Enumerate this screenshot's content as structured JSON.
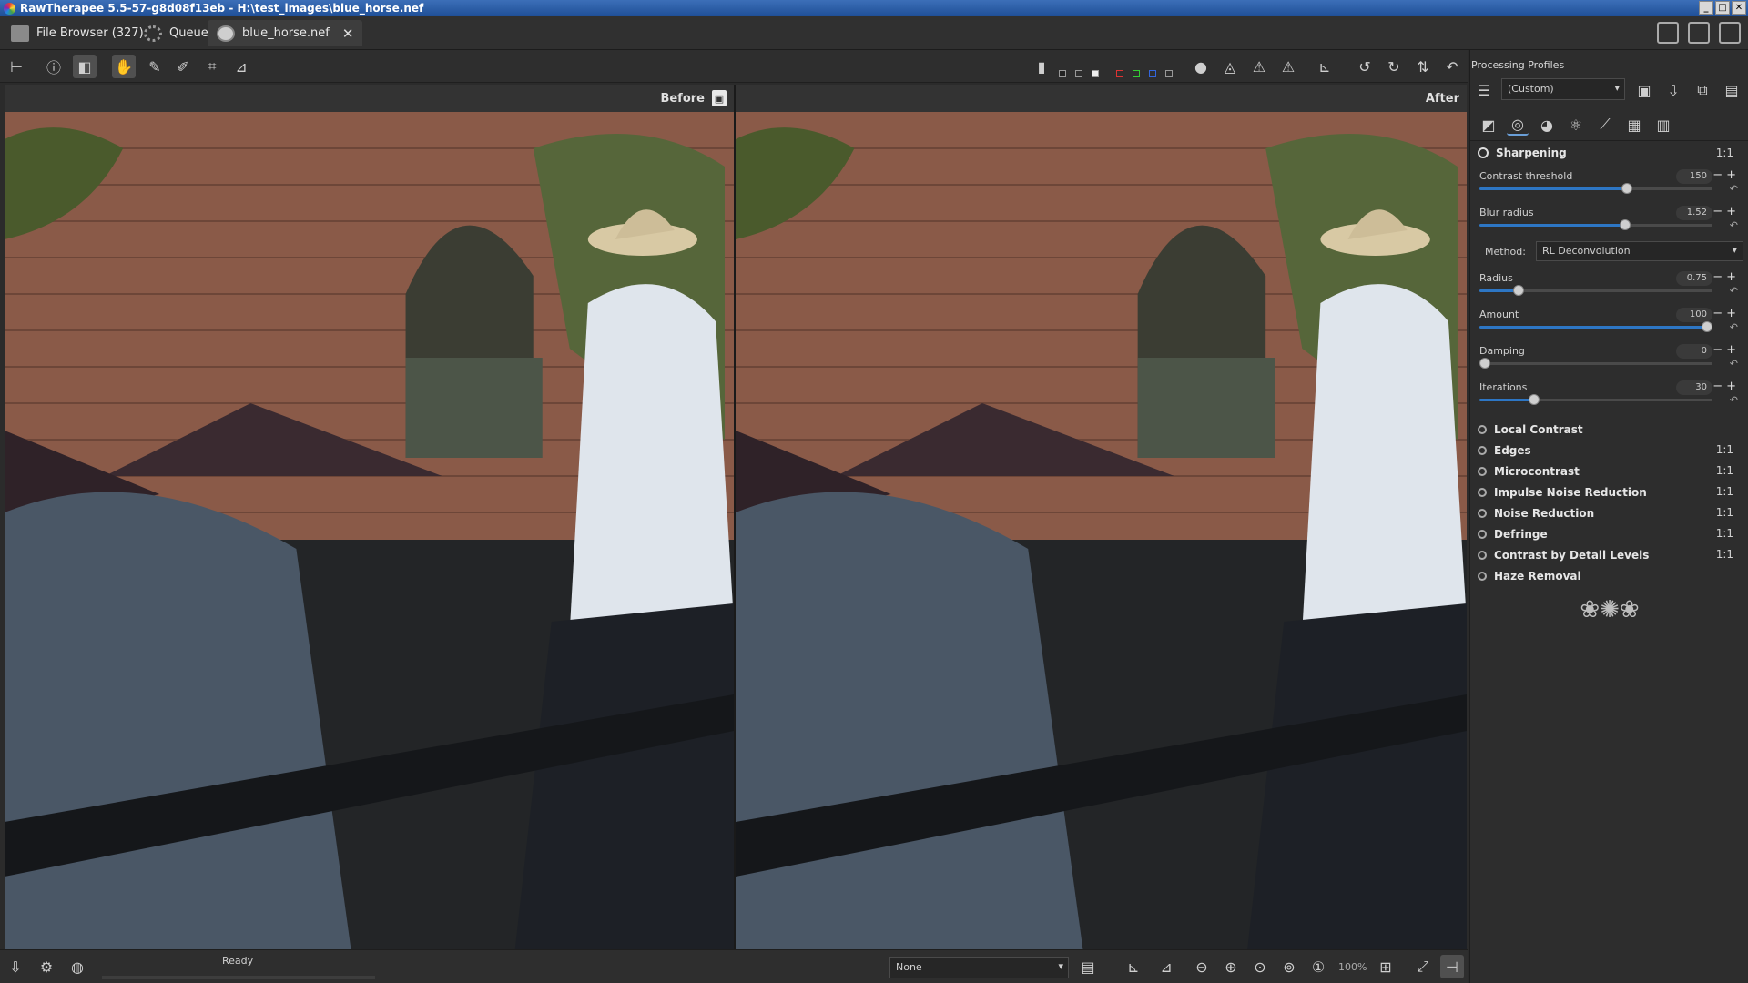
{
  "window": {
    "title": "RawTherapee 5.5-57-g8d08f13eb - H:\\test_images\\blue_horse.nef",
    "controls": [
      "_",
      "□",
      "✕"
    ]
  },
  "tabs": [
    {
      "label": "File Browser (327)",
      "icon": "folder-icon"
    },
    {
      "label": "Queue",
      "icon": "gear-icon"
    },
    {
      "label": "blue_horse.nef",
      "icon": "aperture-icon",
      "close": "✕"
    }
  ],
  "viewer": {
    "before_label": "Before",
    "after_label": "After"
  },
  "status": {
    "text": "Ready",
    "preview_select": "None",
    "zoom": "100%"
  },
  "processing_profiles": {
    "title": "Processing Profiles",
    "selected": "(Custom)"
  },
  "sharpening": {
    "title": "Sharpening",
    "ratio": "1:1",
    "params": [
      {
        "label": "Contrast threshold",
        "value": "150",
        "fraction": 0.64
      },
      {
        "label": "Blur radius",
        "value": "1.52",
        "fraction": 0.63
      },
      {
        "label": "Radius",
        "value": "0.75",
        "fraction": 0.15
      },
      {
        "label": "Amount",
        "value": "100",
        "fraction": 1.0
      },
      {
        "label": "Damping",
        "value": "0",
        "fraction": 0.0
      },
      {
        "label": "Iterations",
        "value": "30",
        "fraction": 0.22
      }
    ],
    "method_label": "Method:",
    "method_value": "RL Deconvolution"
  },
  "sections": [
    {
      "label": "Local Contrast",
      "ratio": ""
    },
    {
      "label": "Edges",
      "ratio": "1:1"
    },
    {
      "label": "Microcontrast",
      "ratio": "1:1"
    },
    {
      "label": "Impulse Noise Reduction",
      "ratio": "1:1"
    },
    {
      "label": "Noise Reduction",
      "ratio": "1:1"
    },
    {
      "label": "Defringe",
      "ratio": "1:1"
    },
    {
      "label": "Contrast by Detail Levels",
      "ratio": "1:1"
    },
    {
      "label": "Haze Removal",
      "ratio": ""
    }
  ]
}
